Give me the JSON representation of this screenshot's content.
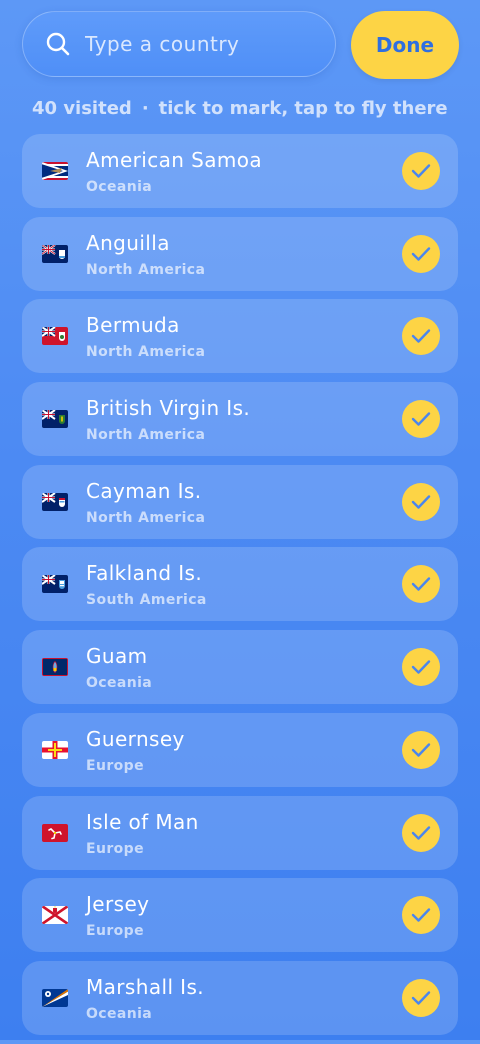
{
  "search": {
    "placeholder": "Type a country",
    "value": ""
  },
  "done_label": "Done",
  "summary": {
    "count_text": "40 visited",
    "separator": "·",
    "hint": "tick to mark, tap to fly there"
  },
  "colors": {
    "accent_yellow": "#fdd445",
    "done_text": "#2f6fe0",
    "background": "#4c8af3"
  },
  "countries": [
    {
      "name": "American Samoa",
      "region": "Oceania",
      "checked": true,
      "flag_icon": "flag-american-samoa"
    },
    {
      "name": "Anguilla",
      "region": "North America",
      "checked": true,
      "flag_icon": "flag-anguilla"
    },
    {
      "name": "Bermuda",
      "region": "North America",
      "checked": true,
      "flag_icon": "flag-bermuda"
    },
    {
      "name": "British Virgin Is.",
      "region": "North America",
      "checked": true,
      "flag_icon": "flag-british-virgin-islands"
    },
    {
      "name": "Cayman Is.",
      "region": "North America",
      "checked": true,
      "flag_icon": "flag-cayman-islands"
    },
    {
      "name": "Falkland Is.",
      "region": "South America",
      "checked": true,
      "flag_icon": "flag-falkland-islands"
    },
    {
      "name": "Guam",
      "region": "Oceania",
      "checked": true,
      "flag_icon": "flag-guam"
    },
    {
      "name": "Guernsey",
      "region": "Europe",
      "checked": true,
      "flag_icon": "flag-guernsey"
    },
    {
      "name": "Isle of Man",
      "region": "Europe",
      "checked": true,
      "flag_icon": "flag-isle-of-man"
    },
    {
      "name": "Jersey",
      "region": "Europe",
      "checked": true,
      "flag_icon": "flag-jersey"
    },
    {
      "name": "Marshall Is.",
      "region": "Oceania",
      "checked": true,
      "flag_icon": "flag-marshall-islands"
    }
  ]
}
